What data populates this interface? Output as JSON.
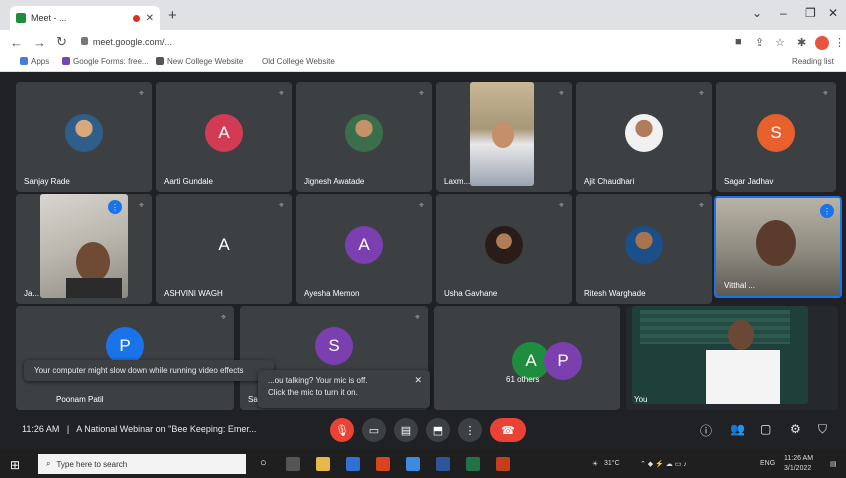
{
  "browser": {
    "tab_title": "Meet - ...",
    "new_tab": "+",
    "url": "meet.google.com/...",
    "bookmarks": [
      "Apps",
      "Google Forms: free...",
      "New College Website",
      "Old College Website"
    ],
    "reading_list": "Reading list"
  },
  "meet": {
    "tiles": [
      {
        "name": "Sanjay Rade",
        "type": "photo"
      },
      {
        "name": "Aarti Gundale",
        "type": "initial",
        "initial": "A",
        "color": "#d33a53"
      },
      {
        "name": "Jignesh Awatade",
        "type": "photo"
      },
      {
        "name": "Laxm...",
        "type": "video"
      },
      {
        "name": "Ajit Chaudhari",
        "type": "photo"
      },
      {
        "name": "Sagar Jadhav",
        "type": "initial",
        "initial": "S",
        "color": "#e8612c"
      },
      {
        "name": "Ja...",
        "type": "video"
      },
      {
        "name": "ASHVINI WAGH",
        "type": "initial",
        "initial": "A",
        "color": "#3c4043"
      },
      {
        "name": "Ayesha Memon",
        "type": "initial",
        "initial": "A",
        "color": "#7b3fb0"
      },
      {
        "name": "Usha Gavhane",
        "type": "photo"
      },
      {
        "name": "Ritesh Warghade",
        "type": "photo"
      },
      {
        "name": "Vitthal ...",
        "type": "video"
      },
      {
        "name": "Poonam Patil",
        "type": "initial",
        "initial": "P",
        "color": "#1a73e8"
      },
      {
        "name": "Sa...",
        "type": "initial",
        "initial": "S",
        "color": "#7b3fb0"
      },
      {
        "name": "61 others",
        "type": "others"
      },
      {
        "name": "You",
        "type": "video"
      }
    ],
    "others_initials": [
      "A",
      "P"
    ],
    "toast_effects": "Your computer might slow down while running video effects",
    "toast_mic_line1": "...ou talking? Your mic is off.",
    "toast_mic_line2": "Click the mic to turn it on.",
    "time": "11:26 AM",
    "separator": "|",
    "meeting_title": "A National Webinar on \"Bee Keeping: Emer...",
    "colors": {
      "end_call": "#ea4335",
      "mic_off": "#ea4335",
      "speaking": "#1a73e8"
    }
  },
  "taskbar": {
    "search_placeholder": "Type here to search",
    "temperature": "31°C",
    "language": "ENG",
    "clock_time": "11:26 AM",
    "clock_date": "3/1/2022"
  }
}
